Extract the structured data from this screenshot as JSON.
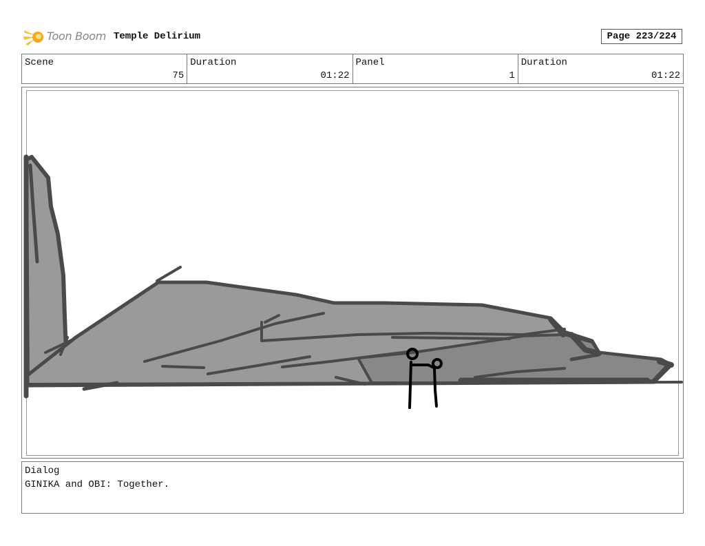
{
  "header": {
    "logo_text": "Toon Boom",
    "project_title": "Temple Delirium",
    "page": "Page 223/224"
  },
  "info": {
    "scene_label": "Scene",
    "scene_value": "75",
    "scene_duration_label": "Duration",
    "scene_duration_value": "01:22",
    "panel_label": "Panel",
    "panel_value": "1",
    "panel_duration_label": "Duration",
    "panel_duration_value": "01:22"
  },
  "dialog": {
    "label": "Dialog",
    "text": "GINIKA and OBI: Together."
  },
  "icons": {
    "logo": "toon-boom-logo-icon"
  },
  "colors": {
    "sketch_fill": "#9a9a9a",
    "sketch_fill_dark": "#888888",
    "sketch_stroke": "#4a4a4a",
    "figure": "#000000"
  }
}
